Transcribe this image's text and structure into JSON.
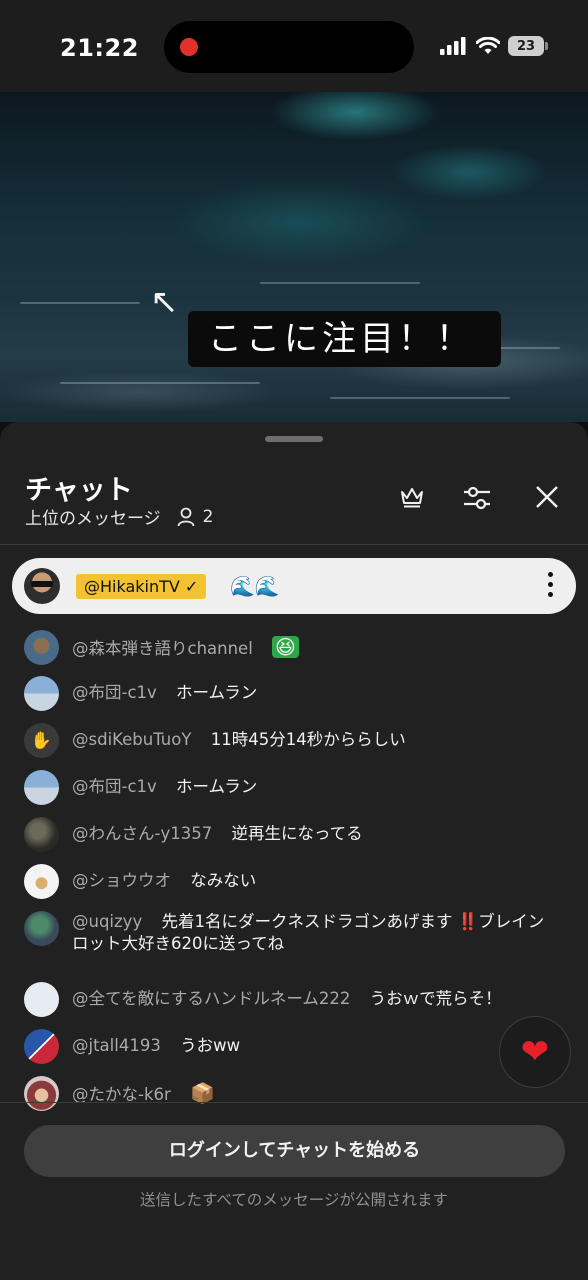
{
  "status": {
    "time": "21:22",
    "battery": "23"
  },
  "video": {
    "caption": "ここに注目！！",
    "arrow": "↖"
  },
  "chat": {
    "title": "チャット",
    "subtitle": "上位のメッセージ",
    "viewer_count": "2",
    "pinned": {
      "author": "@HikakinTV ✓",
      "text": "🌊🌊"
    },
    "messages": [
      {
        "author": "@森本弾き語りchannel",
        "text": "",
        "emoji": "😆"
      },
      {
        "author": "@布団-c1v",
        "text": "ホームラン"
      },
      {
        "author": "@sdiKebuTuoY",
        "text": "11時45分14秒かららしい"
      },
      {
        "author": "@布団-c1v",
        "text": "ホームラン"
      },
      {
        "author": "@わんさん-y1357",
        "text": "逆再生になってる"
      },
      {
        "author": "@ショウウオ",
        "text": "なみない"
      },
      {
        "author": "@uqizyy",
        "text": "先着1名にダークネスドラゴンあげます ‼️ブレインロット大好き620に送ってね"
      },
      {
        "author": "@全てを敵にするハンドルネーム222",
        "text": "うおｗで荒らそ！"
      },
      {
        "author": "@jtall4193",
        "text": "うおww"
      },
      {
        "author": "@たかな-k6r",
        "text": "",
        "emoji": "📦"
      }
    ],
    "login_button": "ログインしてチャットを始める",
    "note": "送信したすべてのメッセージが公開されます"
  },
  "colors": {
    "panel": "#212121",
    "owner_tag": "#f2c230",
    "heart": "#e8202a"
  }
}
